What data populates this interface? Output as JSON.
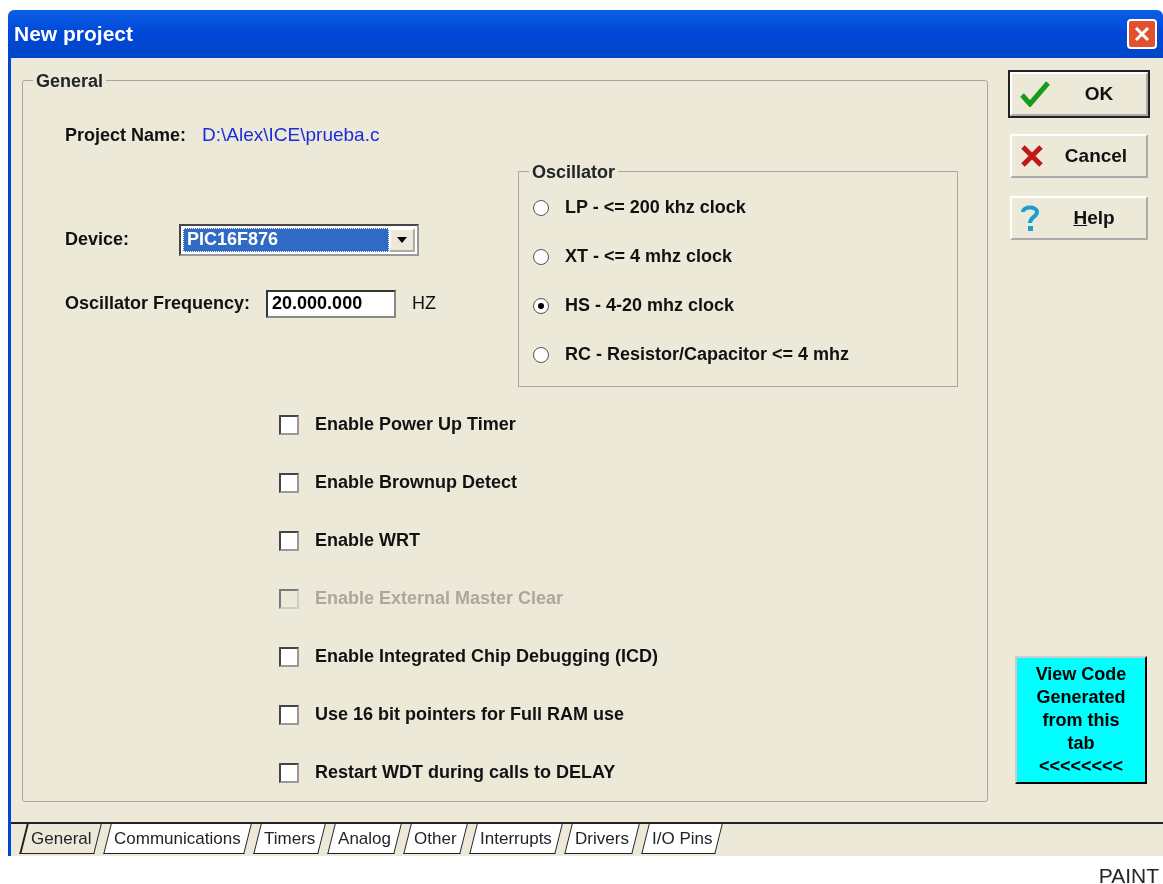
{
  "window": {
    "title": "New project"
  },
  "group": {
    "title": "General",
    "project_name": {
      "label": "Project Name:",
      "value": "D:\\Alex\\ICE\\prueba.c"
    },
    "device": {
      "label": "Device:",
      "value": "PIC16F876"
    },
    "frequency": {
      "label": "Oscillator Frequency:",
      "value": "20.000.000",
      "unit": "HZ"
    },
    "oscillator": {
      "title": "Oscillator",
      "options": [
        {
          "label": "LP - <= 200 khz clock",
          "selected": false
        },
        {
          "label": "XT - <= 4 mhz clock",
          "selected": false
        },
        {
          "label": "HS - 4-20 mhz clock",
          "selected": true
        },
        {
          "label": "RC - Resistor/Capacitor <= 4 mhz",
          "selected": false
        }
      ]
    },
    "checkboxes": [
      {
        "label": "Enable Power Up Timer",
        "checked": false,
        "disabled": false
      },
      {
        "label": "Enable Brownup Detect",
        "checked": false,
        "disabled": false
      },
      {
        "label": "Enable WRT",
        "checked": false,
        "disabled": false
      },
      {
        "label": "Enable External Master Clear",
        "checked": false,
        "disabled": true
      },
      {
        "label": "Enable Integrated Chip Debugging (ICD)",
        "checked": false,
        "disabled": false
      },
      {
        "label": "Use 16 bit pointers for Full RAM use",
        "checked": false,
        "disabled": false
      },
      {
        "label": "Restart WDT during calls to DELAY",
        "checked": false,
        "disabled": false
      }
    ]
  },
  "buttons": [
    {
      "kind": "ok",
      "label": "OK",
      "default": true,
      "mnemonic": false
    },
    {
      "kind": "cancel",
      "label": "Cancel",
      "default": false,
      "mnemonic": false
    },
    {
      "kind": "help",
      "label": "Help",
      "default": false,
      "mnemonic": true
    }
  ],
  "view_code_button": {
    "lines": [
      "View Code",
      "Generated",
      "from this",
      "tab",
      "<<<<<<<<"
    ]
  },
  "tabs": [
    {
      "label": "General",
      "selected": true
    },
    {
      "label": "Communications",
      "selected": false
    },
    {
      "label": "Timers",
      "selected": false
    },
    {
      "label": "Analog",
      "selected": false
    },
    {
      "label": "Other",
      "selected": false
    },
    {
      "label": "Interrupts",
      "selected": false
    },
    {
      "label": "Drivers",
      "selected": false
    },
    {
      "label": "I/O Pins",
      "selected": false
    }
  ],
  "footer_text": "PAINT"
}
